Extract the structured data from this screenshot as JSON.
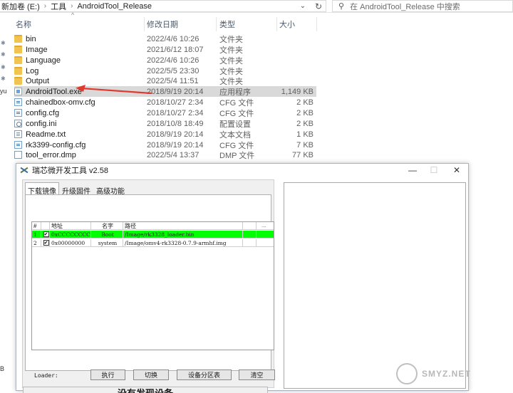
{
  "explorer": {
    "breadcrumb": [
      "新加卷 (E:)",
      "工具",
      "AndroidTool_Release"
    ],
    "search_placeholder": "在 AndroidTool_Release 中搜索",
    "columns": {
      "name": "名称",
      "date": "修改日期",
      "type": "类型",
      "size": "大小"
    },
    "left_labels": [
      "yu",
      "B"
    ],
    "files": [
      {
        "name": "bin",
        "date": "2022/4/6 10:26",
        "type": "文件夹",
        "size": "",
        "icon": "folder-icon"
      },
      {
        "name": "Image",
        "date": "2021/6/12 18:07",
        "type": "文件夹",
        "size": "",
        "icon": "folder-icon"
      },
      {
        "name": "Language",
        "date": "2022/4/6 10:26",
        "type": "文件夹",
        "size": "",
        "icon": "folder-icon"
      },
      {
        "name": "Log",
        "date": "2022/5/5 23:30",
        "type": "文件夹",
        "size": "",
        "icon": "folder-icon"
      },
      {
        "name": "Output",
        "date": "2022/5/4 11:51",
        "type": "文件夹",
        "size": "",
        "icon": "folder-icon"
      },
      {
        "name": "AndroidTool.exe",
        "date": "2018/9/19 20:14",
        "type": "应用程序",
        "size": "1,149 KB",
        "icon": "exe-icon"
      },
      {
        "name": "chainedbox-omv.cfg",
        "date": "2018/10/27 2:34",
        "type": "CFG 文件",
        "size": "2 KB",
        "icon": "cfg-file-icon"
      },
      {
        "name": "config.cfg",
        "date": "2018/10/27 2:34",
        "type": "CFG 文件",
        "size": "2 KB",
        "icon": "cfg-file-icon"
      },
      {
        "name": "config.ini",
        "date": "2018/10/8 18:49",
        "type": "配置设置",
        "size": "2 KB",
        "icon": "ini-file-icon"
      },
      {
        "name": "Readme.txt",
        "date": "2018/9/19 20:14",
        "type": "文本文档",
        "size": "1 KB",
        "icon": "txt-file-icon"
      },
      {
        "name": "rk3399-config.cfg",
        "date": "2018/9/19 20:14",
        "type": "CFG 文件",
        "size": "7 KB",
        "icon": "cfg-file-icon"
      },
      {
        "name": "tool_error.dmp",
        "date": "2022/5/4 13:37",
        "type": "DMP 文件",
        "size": "77 KB",
        "icon": "dmp-file-icon"
      }
    ]
  },
  "tool": {
    "title": "瑞芯微开发工具 v2.58",
    "window_buttons": {
      "minimize": "—",
      "maximize": "☐",
      "close": "✕"
    },
    "tabs": [
      "下载镜像",
      "升级固件",
      "高级功能"
    ],
    "grid": {
      "headers": [
        "#",
        "",
        "地址",
        "名字",
        "路径",
        ""
      ],
      "rows": [
        {
          "num": "1",
          "checked": "✔",
          "addr": "0xCCCCCCCC",
          "name": "Boot",
          "path": "/Image/rk3328_loader.bin",
          "more": ""
        },
        {
          "num": "2",
          "checked": "✔",
          "addr": "0x00000000",
          "name": "system",
          "path": "/Image/omv4-rk3328-0.7.9-armhf.img",
          "more": ""
        }
      ],
      "more_label": "..."
    },
    "loader_label": "Loader:",
    "buttons": {
      "run": "执行",
      "switch": "切换",
      "partition": "设备分区表",
      "clear": "清空"
    },
    "status": "没有发现设备"
  },
  "watermark": "SMYZ.NET",
  "colors": {
    "selected_row": "#00ff00",
    "annotation_arrow": "#e03a2e"
  }
}
